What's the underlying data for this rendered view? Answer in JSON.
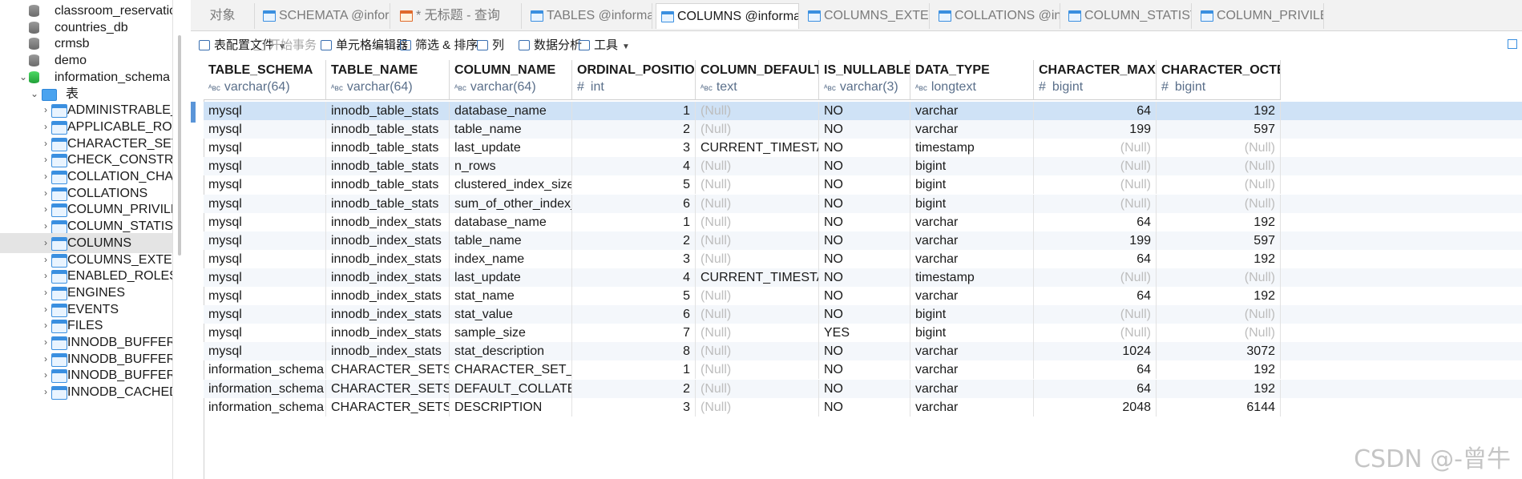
{
  "sidebar": {
    "items": [
      {
        "label": "classroom_reservation",
        "kind": "db",
        "indent": 1
      },
      {
        "label": "countries_db",
        "kind": "db",
        "indent": 1
      },
      {
        "label": "crmsb",
        "kind": "db",
        "indent": 1
      },
      {
        "label": "demo",
        "kind": "db",
        "indent": 1
      },
      {
        "label": "information_schema",
        "kind": "db-open",
        "indent": 1
      },
      {
        "label": "表",
        "kind": "folder",
        "indent": 2
      },
      {
        "label": "ADMINISTRABLE_ROLE_AUTHORIZATIONS",
        "kind": "table",
        "indent": 3
      },
      {
        "label": "APPLICABLE_ROLES",
        "kind": "table",
        "indent": 3
      },
      {
        "label": "CHARACTER_SETS",
        "kind": "table",
        "indent": 3
      },
      {
        "label": "CHECK_CONSTRAINTS",
        "kind": "table",
        "indent": 3
      },
      {
        "label": "COLLATION_CHARACTER_SET_APPLICABILITY",
        "kind": "table",
        "indent": 3
      },
      {
        "label": "COLLATIONS",
        "kind": "table",
        "indent": 3
      },
      {
        "label": "COLUMN_PRIVILEGES",
        "kind": "table",
        "indent": 3
      },
      {
        "label": "COLUMN_STATISTICS",
        "kind": "table",
        "indent": 3
      },
      {
        "label": "COLUMNS",
        "kind": "table",
        "indent": 3,
        "selected": true
      },
      {
        "label": "COLUMNS_EXTENSIONS",
        "kind": "table",
        "indent": 3
      },
      {
        "label": "ENABLED_ROLES",
        "kind": "table",
        "indent": 3
      },
      {
        "label": "ENGINES",
        "kind": "table",
        "indent": 3
      },
      {
        "label": "EVENTS",
        "kind": "table",
        "indent": 3
      },
      {
        "label": "FILES",
        "kind": "table",
        "indent": 3
      },
      {
        "label": "INNODB_BUFFER_PAGE",
        "kind": "table",
        "indent": 3
      },
      {
        "label": "INNODB_BUFFER_PAGE_LRU",
        "kind": "table",
        "indent": 3
      },
      {
        "label": "INNODB_BUFFER_POOL_STATS",
        "kind": "table",
        "indent": 3
      },
      {
        "label": "INNODB_CACHED_INDEXES",
        "kind": "table",
        "indent": 3
      }
    ]
  },
  "tabs": [
    {
      "label": "对象",
      "icon": "none"
    },
    {
      "label": "SCHEMATA @information_schema",
      "icon": "table"
    },
    {
      "label": "* 无标题 - 查询",
      "icon": "query"
    },
    {
      "label": "TABLES @information_schema",
      "icon": "table"
    },
    {
      "label": "COLUMNS @information_schema",
      "icon": "table",
      "active": true
    },
    {
      "label": "COLUMNS_EXTENSIONS @information_schema",
      "icon": "table"
    },
    {
      "label": "COLLATIONS @information_schema",
      "icon": "table"
    },
    {
      "label": "COLUMN_STATISTICS @information_schema",
      "icon": "table"
    },
    {
      "label": "COLUMN_PRIVILEGES @information_schema",
      "icon": "table"
    }
  ],
  "toolbar": {
    "table_config": "表配置文件",
    "begin_tx": "开始事务",
    "cell_editor": "单元格编辑器",
    "filter_sort": "筛选 & 排序",
    "columns": "列",
    "data_analysis": "数据分析",
    "tools": "工具"
  },
  "grid": {
    "columns": [
      {
        "name": "TABLE_SCHEMA",
        "type": "varchar(64)",
        "kind": "text"
      },
      {
        "name": "TABLE_NAME",
        "type": "varchar(64)",
        "kind": "text"
      },
      {
        "name": "COLUMN_NAME",
        "type": "varchar(64)",
        "kind": "text"
      },
      {
        "name": "ORDINAL_POSITION",
        "type": "int",
        "kind": "num"
      },
      {
        "name": "COLUMN_DEFAULT",
        "type": "text",
        "kind": "text"
      },
      {
        "name": "IS_NULLABLE",
        "type": "varchar(3)",
        "kind": "text"
      },
      {
        "name": "DATA_TYPE",
        "type": "longtext",
        "kind": "text"
      },
      {
        "name": "CHARACTER_MAXIMUM_LENGTH",
        "type": "bigint",
        "kind": "num"
      },
      {
        "name": "CHARACTER_OCTET_LENGTH",
        "type": "bigint",
        "kind": "num"
      }
    ],
    "null_text": "(Null)",
    "rows": [
      [
        "mysql",
        "innodb_table_stats",
        "database_name",
        "1",
        null,
        "NO",
        "varchar",
        "64",
        "192"
      ],
      [
        "mysql",
        "innodb_table_stats",
        "table_name",
        "2",
        null,
        "NO",
        "varchar",
        "199",
        "597"
      ],
      [
        "mysql",
        "innodb_table_stats",
        "last_update",
        "3",
        "CURRENT_TIMESTAMP",
        "NO",
        "timestamp",
        null,
        null
      ],
      [
        "mysql",
        "innodb_table_stats",
        "n_rows",
        "4",
        null,
        "NO",
        "bigint",
        null,
        null
      ],
      [
        "mysql",
        "innodb_table_stats",
        "clustered_index_size",
        "5",
        null,
        "NO",
        "bigint",
        null,
        null
      ],
      [
        "mysql",
        "innodb_table_stats",
        "sum_of_other_index_sizes",
        "6",
        null,
        "NO",
        "bigint",
        null,
        null
      ],
      [
        "mysql",
        "innodb_index_stats",
        "database_name",
        "1",
        null,
        "NO",
        "varchar",
        "64",
        "192"
      ],
      [
        "mysql",
        "innodb_index_stats",
        "table_name",
        "2",
        null,
        "NO",
        "varchar",
        "199",
        "597"
      ],
      [
        "mysql",
        "innodb_index_stats",
        "index_name",
        "3",
        null,
        "NO",
        "varchar",
        "64",
        "192"
      ],
      [
        "mysql",
        "innodb_index_stats",
        "last_update",
        "4",
        "CURRENT_TIMESTAMP",
        "NO",
        "timestamp",
        null,
        null
      ],
      [
        "mysql",
        "innodb_index_stats",
        "stat_name",
        "5",
        null,
        "NO",
        "varchar",
        "64",
        "192"
      ],
      [
        "mysql",
        "innodb_index_stats",
        "stat_value",
        "6",
        null,
        "NO",
        "bigint",
        null,
        null
      ],
      [
        "mysql",
        "innodb_index_stats",
        "sample_size",
        "7",
        null,
        "YES",
        "bigint",
        null,
        null
      ],
      [
        "mysql",
        "innodb_index_stats",
        "stat_description",
        "8",
        null,
        "NO",
        "varchar",
        "1024",
        "3072"
      ],
      [
        "information_schema",
        "CHARACTER_SETS",
        "CHARACTER_SET_NAME",
        "1",
        null,
        "NO",
        "varchar",
        "64",
        "192"
      ],
      [
        "information_schema",
        "CHARACTER_SETS",
        "DEFAULT_COLLATE_NAME",
        "2",
        null,
        "NO",
        "varchar",
        "64",
        "192"
      ],
      [
        "information_schema",
        "CHARACTER_SETS",
        "DESCRIPTION",
        "3",
        null,
        "NO",
        "varchar",
        "2048",
        "6144"
      ]
    ]
  },
  "watermark": "CSDN @-曾牛"
}
